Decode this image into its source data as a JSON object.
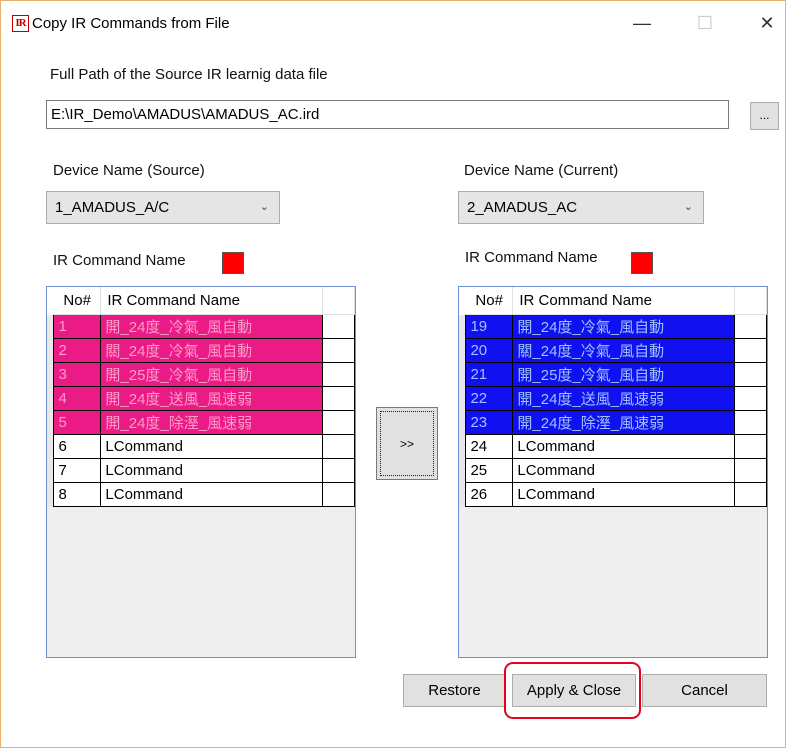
{
  "window": {
    "title": "Copy IR Commands from File",
    "app_icon_text": "IR",
    "minimize": "—",
    "maximize": "☐",
    "close": "✕"
  },
  "source_file": {
    "label": "Full Path of the Source IR learnig data file",
    "value": "E:\\IR_Demo\\AMADUS\\AMADUS_AC.ird",
    "browse_label": "..."
  },
  "source": {
    "device_label": "Device Name (Source)",
    "device_value": "1_AMADUS_A/C",
    "cmd_label": "IR Command Name",
    "swatch_color": "#ff0000",
    "columns": [
      "No#",
      "IR Command Name"
    ],
    "rows": [
      {
        "no": "1",
        "name": "開_24度_冷氣_風自動"
      },
      {
        "no": "2",
        "name": "關_24度_冷氣_風自動"
      },
      {
        "no": "3",
        "name": "開_25度_冷氣_風自動"
      },
      {
        "no": "4",
        "name": "開_24度_送風_風速弱"
      },
      {
        "no": "5",
        "name": "開_24度_除溼_風速弱"
      },
      {
        "no": "6",
        "name": "LCommand"
      },
      {
        "no": "7",
        "name": "LCommand"
      },
      {
        "no": "8",
        "name": "LCommand"
      }
    ],
    "selected_color": "#ea1a86"
  },
  "current": {
    "device_label": "Device Name (Current)",
    "device_value": "2_AMADUS_AC",
    "cmd_label": "IR Command Name",
    "swatch_color": "#ff0000",
    "columns": [
      "No#",
      "IR Command Name"
    ],
    "rows": [
      {
        "no": "19",
        "name": "開_24度_冷氣_風自動"
      },
      {
        "no": "20",
        "name": "關_24度_冷氣_風自動"
      },
      {
        "no": "21",
        "name": "開_25度_冷氣_風自動"
      },
      {
        "no": "22",
        "name": "開_24度_送風_風速弱"
      },
      {
        "no": "23",
        "name": "開_24度_除溼_風速弱"
      },
      {
        "no": "24",
        "name": "LCommand"
      },
      {
        "no": "25",
        "name": "LCommand"
      },
      {
        "no": "26",
        "name": "LCommand"
      }
    ],
    "selected_color": "#1010f0"
  },
  "actions": {
    "move": ">>",
    "restore": "Restore",
    "apply_close": "Apply & Close",
    "cancel": "Cancel"
  }
}
